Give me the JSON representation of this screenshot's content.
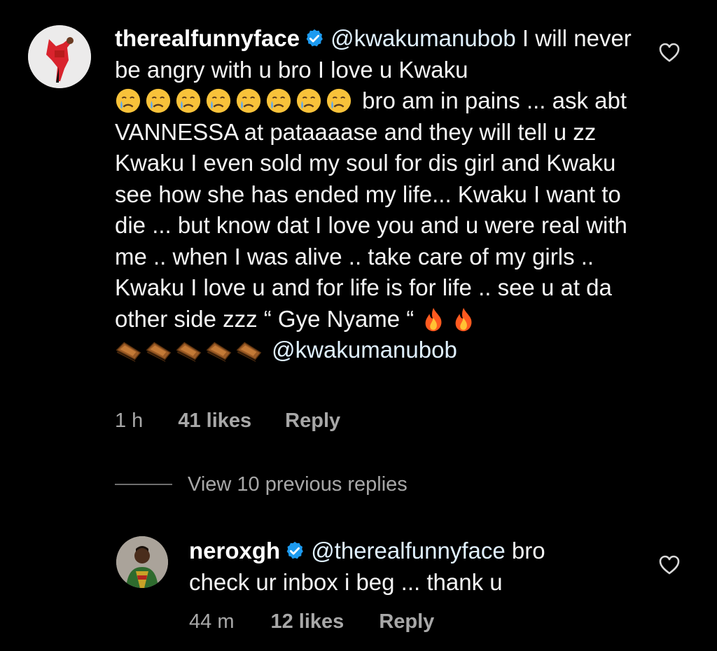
{
  "main_comment": {
    "username": "therealfunnyface",
    "mention": "@kwakumanubob",
    "text_line1": " I will never be angry with u bro I love u Kwaku",
    "crying_emojis": [
      "crying-face-icon",
      "crying-face-icon",
      "crying-face-icon",
      "crying-face-icon",
      "crying-face-icon",
      "crying-face-icon",
      "crying-face-icon",
      "crying-face-icon"
    ],
    "text_after_emojis": " bro am in pains ... ask abt VANNESSA at pataaaase and they will tell u zz Kwaku I even sold my soul for dis girl and Kwaku see how she has ended my life... Kwaku I want to die ... but know dat I love you and u were real with me .. when I was alive .. take care of my girls .. Kwaku I love u and for life is for life .. see u at da other side zzz “ Gye Nyame “ ",
    "fire_emojis": [
      "fire-icon",
      "fire-icon"
    ],
    "coffin_emojis": [
      "coffin-icon",
      "coffin-icon",
      "coffin-icon",
      "coffin-icon",
      "coffin-icon"
    ],
    "trailing_mention": "@kwakumanubob",
    "time": "1 h",
    "likes": "41 likes",
    "reply_label": "Reply"
  },
  "view_previous_replies": "View 10 previous replies",
  "reply_comment": {
    "username": "neroxgh",
    "mention": "@therealfunnyface",
    "text": " bro check ur inbox i beg ... thank u",
    "time": "44 m",
    "likes": "12 likes",
    "reply_label": "Reply"
  },
  "colors": {
    "background": "#000000",
    "text": "#f5f5f5",
    "meta": "#a8a8a8",
    "verified": "#1d9bf0"
  }
}
